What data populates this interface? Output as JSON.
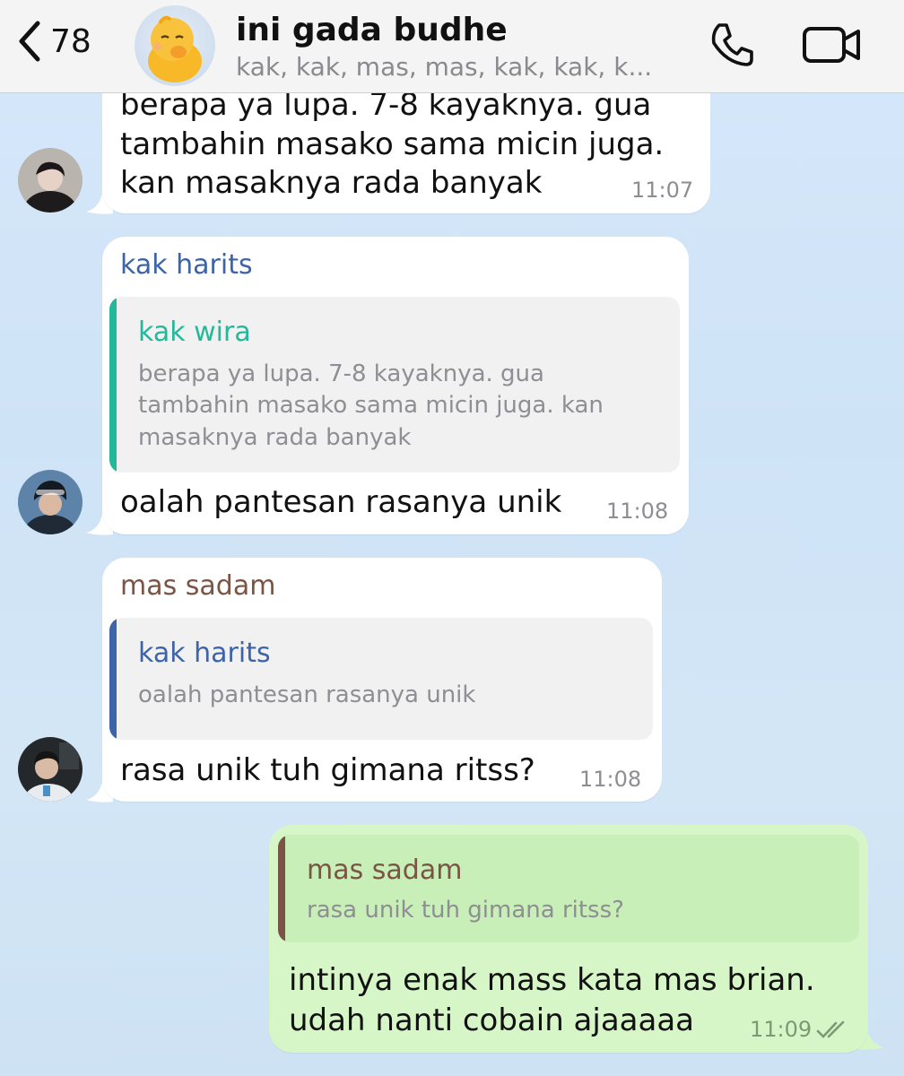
{
  "header": {
    "back_count": "78",
    "title": "ini gada budhe",
    "subtitle": "kak, kak, mas, mas, kak, kak, k..."
  },
  "icons": {
    "back": "chevron-left-icon",
    "call": "phone-icon",
    "video": "video-camera-icon",
    "read": "double-check-icon"
  },
  "colors": {
    "harits": "#3d64a8",
    "wira": "#24b89a",
    "sadam": "#7a5445",
    "outgoing_bubble": "#d7f6c8"
  },
  "messages": [
    {
      "lines": [
        "berapa ya lupa. 7-8 kayaknya. gua",
        "tambahin masako sama micin juga.",
        "kan masaknya rada banyak"
      ],
      "time": "11:07"
    },
    {
      "sender": "kak harits",
      "reply": {
        "name": "kak wira",
        "lines": [
          "berapa ya lupa. 7-8 kayaknya. gua",
          "tambahin masako sama micin juga. kan",
          "masaknya rada banyak"
        ]
      },
      "text": "oalah pantesan rasanya unik",
      "time": "11:08"
    },
    {
      "sender": "mas sadam",
      "reply": {
        "name": "kak harits",
        "text": "oalah pantesan rasanya unik"
      },
      "text": "rasa unik tuh gimana ritss?",
      "time": "11:08"
    },
    {
      "reply": {
        "name": "mas sadam",
        "text": "rasa unik tuh gimana ritss?"
      },
      "lines": [
        "intinya enak mass kata mas brian.",
        "udah nanti cobain ajaaaaa"
      ],
      "time": "11:09"
    }
  ]
}
